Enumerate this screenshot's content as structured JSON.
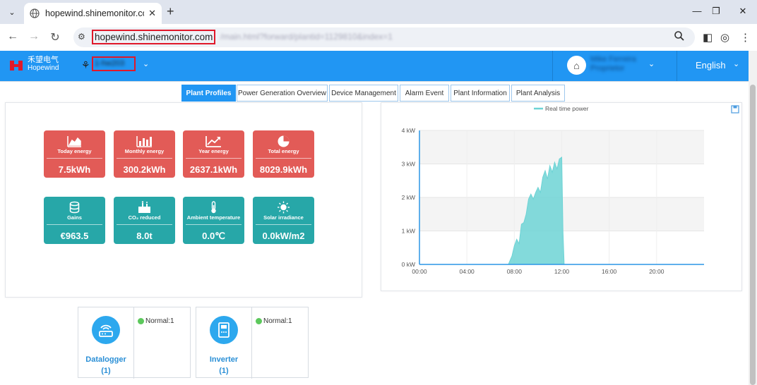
{
  "browser": {
    "tab_title": "hopewind.shinemonitor.com/m",
    "url_host": "hopewind.shinemonitor.com",
    "url_path": "/main.html?forward/plantid=1129810&index=1"
  },
  "app": {
    "logo_cn": "禾望电气",
    "logo_en": "Hopewind",
    "plant_name": "1-hw203",
    "user_name": "Mike Ferreira",
    "user_role": "Proprietor",
    "language": "English"
  },
  "tabs": [
    "Plant Profiles",
    "Power Generation Overview",
    "Device Management",
    "Alarm Event",
    "Plant Information",
    "Plant Analysis"
  ],
  "cards_energy": [
    {
      "label": "Today energy",
      "value": "7.5kWh",
      "icon": "area-chart-icon"
    },
    {
      "label": "Monthly energy",
      "value": "300.2kWh",
      "icon": "bar-chart-icon"
    },
    {
      "label": "Year energy",
      "value": "2637.1kWh",
      "icon": "trend-icon"
    },
    {
      "label": "Total energy",
      "value": "8029.9kWh",
      "icon": "pie-icon"
    }
  ],
  "cards_env": [
    {
      "label": "Gains",
      "value": "€963.5",
      "icon": "coins-icon"
    },
    {
      "label": "CO₂ reduced",
      "value": "8.0t",
      "icon": "factory-icon"
    },
    {
      "label": "Ambient temperature",
      "value": "0.0℃",
      "icon": "thermometer-icon"
    },
    {
      "label": "Solar irradiance",
      "value": "0.0kW/m2",
      "icon": "sun-icon"
    }
  ],
  "devices": [
    {
      "name": "Datalogger",
      "count": "(1)",
      "status": "Normal:",
      "status_count": "1",
      "icon": "router-icon"
    },
    {
      "name": "Inverter",
      "count": "(1)",
      "status": "Normal:",
      "status_count": "1",
      "icon": "inverter-icon"
    }
  ],
  "chart_data": {
    "type": "area",
    "legend": [
      "Real time power"
    ],
    "legend_position": "top-center",
    "x_ticks": [
      "00:00",
      "04:00",
      "08:00",
      "12:00",
      "16:00",
      "20:00"
    ],
    "y_ticks": [
      "0 kW",
      "1 kW",
      "2 kW",
      "3 kW",
      "4 kW"
    ],
    "xlim": [
      0,
      24
    ],
    "ylim": [
      0,
      4
    ],
    "grid": true,
    "color": "#6dd3d5",
    "series": [
      {
        "name": "Real time power",
        "x": [
          7.5,
          7.8,
          8.0,
          8.2,
          8.4,
          8.6,
          8.8,
          9.0,
          9.2,
          9.4,
          9.6,
          9.8,
          10.0,
          10.2,
          10.4,
          10.6,
          10.8,
          11.0,
          11.2,
          11.4,
          11.6,
          11.8,
          12.0,
          12.1,
          12.2
        ],
        "y": [
          0.0,
          0.25,
          0.55,
          0.75,
          0.62,
          1.2,
          1.25,
          1.5,
          1.95,
          2.1,
          1.95,
          2.15,
          2.3,
          2.15,
          2.6,
          2.8,
          2.55,
          2.95,
          2.75,
          3.05,
          2.85,
          3.15,
          3.2,
          1.0,
          0.0
        ]
      }
    ]
  },
  "colors": {
    "header": "#2196f3",
    "energy_card": "#e25b57",
    "env_card": "#27a7a8",
    "url_highlight": "#e0182a"
  }
}
